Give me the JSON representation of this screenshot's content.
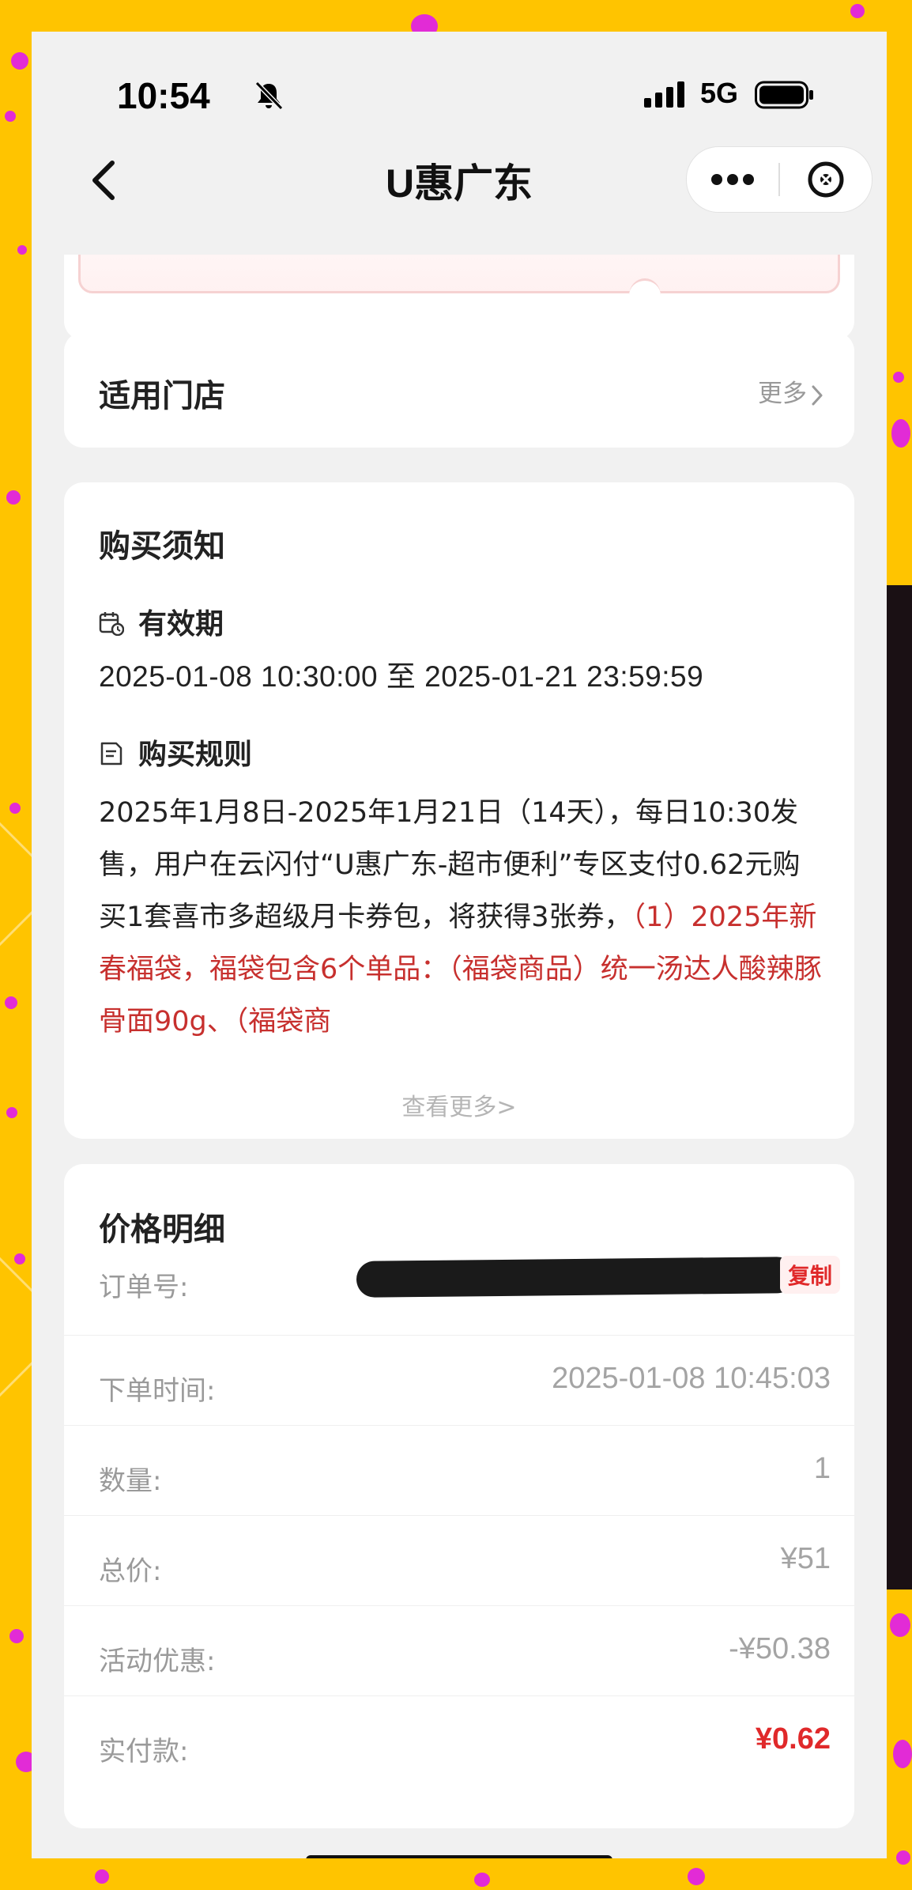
{
  "status_bar": {
    "time": "10:54",
    "network": "5G",
    "icons": [
      "bell-slash-icon",
      "signal-icon",
      "battery-icon"
    ]
  },
  "nav": {
    "title": "U惠广东",
    "back_icon": "chevron-left-icon",
    "more_icon": "ellipsis-icon",
    "close_icon": "close-circle-icon"
  },
  "stores": {
    "title": "适用门店",
    "more_label": "更多"
  },
  "notice": {
    "title": "购买须知",
    "validity_label": "有效期",
    "validity_value": "2025-01-08 10:30:00 至 2025-01-21 23:59:59",
    "rules_label": "购买规则",
    "rules_text": "2025年1月8日-2025年1月21日（14天），每日10:30发售，用户在云闪付“U惠广东-超市便利”专区支付0.62元购买1套喜市多超级月卡券包，将获得3张券，",
    "rules_highlight": "（1）2025年新春福袋，福袋包含6个单品：（福袋商品）统一汤达人酸辣豚骨面90g、（福袋商",
    "see_more": "查看更多>"
  },
  "price": {
    "title": "价格明细",
    "copy_label": "复制",
    "rows": [
      {
        "label": "订单号:",
        "value": ""
      },
      {
        "label": "下单时间:",
        "value": "2025-01-08 10:45:03"
      },
      {
        "label": "数量:",
        "value": "1"
      },
      {
        "label": "总价:",
        "value": "¥51"
      },
      {
        "label": "活动优惠:",
        "value": "-¥50.38"
      },
      {
        "label": "实付款:",
        "value": "¥0.62"
      }
    ]
  },
  "colors": {
    "background": "#FFC400",
    "accent_red": "#E0292A",
    "rule_red": "#C7302E"
  }
}
